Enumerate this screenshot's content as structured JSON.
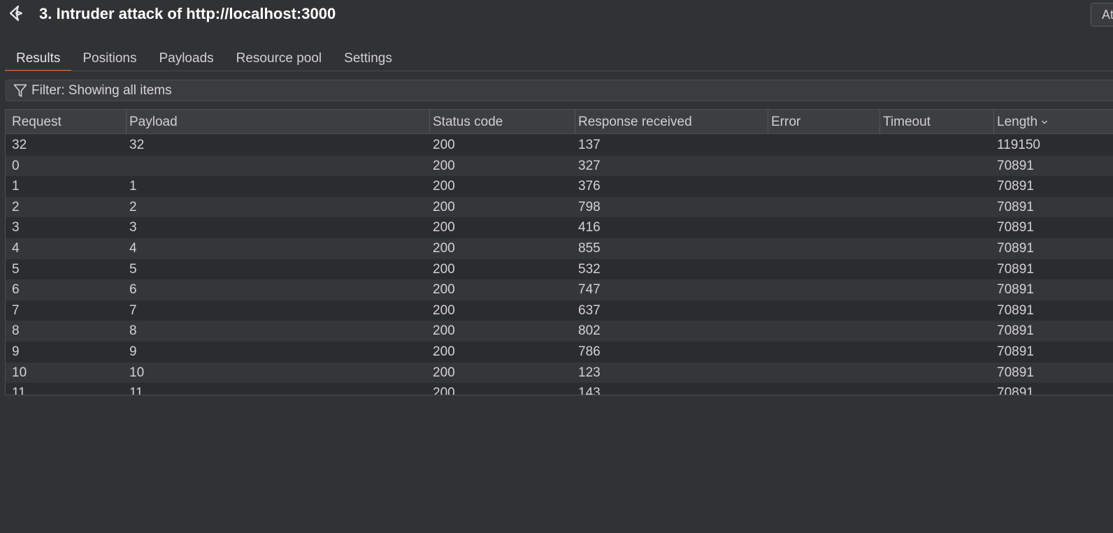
{
  "window": {
    "title": "3. Intruder attack of http://localhost:3000",
    "corner_button_label": "At"
  },
  "tabs": [
    {
      "label": "Results",
      "active": true
    },
    {
      "label": "Positions",
      "active": false
    },
    {
      "label": "Payloads",
      "active": false
    },
    {
      "label": "Resource pool",
      "active": false
    },
    {
      "label": "Settings",
      "active": false
    }
  ],
  "filter": {
    "text": "Filter: Showing all items"
  },
  "table": {
    "columns": [
      "Request",
      "Payload",
      "Status code",
      "Response received",
      "Error",
      "Timeout",
      "Length"
    ],
    "sorted_column": "Length",
    "rows": [
      {
        "request": "32",
        "payload": "32",
        "status": "200",
        "response": "137",
        "error": "",
        "timeout": "",
        "length": "119150"
      },
      {
        "request": "0",
        "payload": "",
        "status": "200",
        "response": "327",
        "error": "",
        "timeout": "",
        "length": "70891"
      },
      {
        "request": "1",
        "payload": "1",
        "status": "200",
        "response": "376",
        "error": "",
        "timeout": "",
        "length": "70891"
      },
      {
        "request": "2",
        "payload": "2",
        "status": "200",
        "response": "798",
        "error": "",
        "timeout": "",
        "length": "70891"
      },
      {
        "request": "3",
        "payload": "3",
        "status": "200",
        "response": "416",
        "error": "",
        "timeout": "",
        "length": "70891"
      },
      {
        "request": "4",
        "payload": "4",
        "status": "200",
        "response": "855",
        "error": "",
        "timeout": "",
        "length": "70891"
      },
      {
        "request": "5",
        "payload": "5",
        "status": "200",
        "response": "532",
        "error": "",
        "timeout": "",
        "length": "70891"
      },
      {
        "request": "6",
        "payload": "6",
        "status": "200",
        "response": "747",
        "error": "",
        "timeout": "",
        "length": "70891"
      },
      {
        "request": "7",
        "payload": "7",
        "status": "200",
        "response": "637",
        "error": "",
        "timeout": "",
        "length": "70891"
      },
      {
        "request": "8",
        "payload": "8",
        "status": "200",
        "response": "802",
        "error": "",
        "timeout": "",
        "length": "70891"
      },
      {
        "request": "9",
        "payload": "9",
        "status": "200",
        "response": "786",
        "error": "",
        "timeout": "",
        "length": "70891"
      },
      {
        "request": "10",
        "payload": "10",
        "status": "200",
        "response": "123",
        "error": "",
        "timeout": "",
        "length": "70891"
      },
      {
        "request": "11",
        "payload": "11",
        "status": "200",
        "response": "143",
        "error": "",
        "timeout": "",
        "length": "70891"
      }
    ]
  },
  "colors": {
    "accent": "#e8672c",
    "background": "#313234",
    "header_bg": "#3d3e42",
    "row_odd": "#2b2c2e",
    "row_even": "#353639"
  },
  "icons": {
    "app": "burp-intruder-icon",
    "filter": "filter-funnel-icon",
    "sort": "chevron-down-icon"
  }
}
